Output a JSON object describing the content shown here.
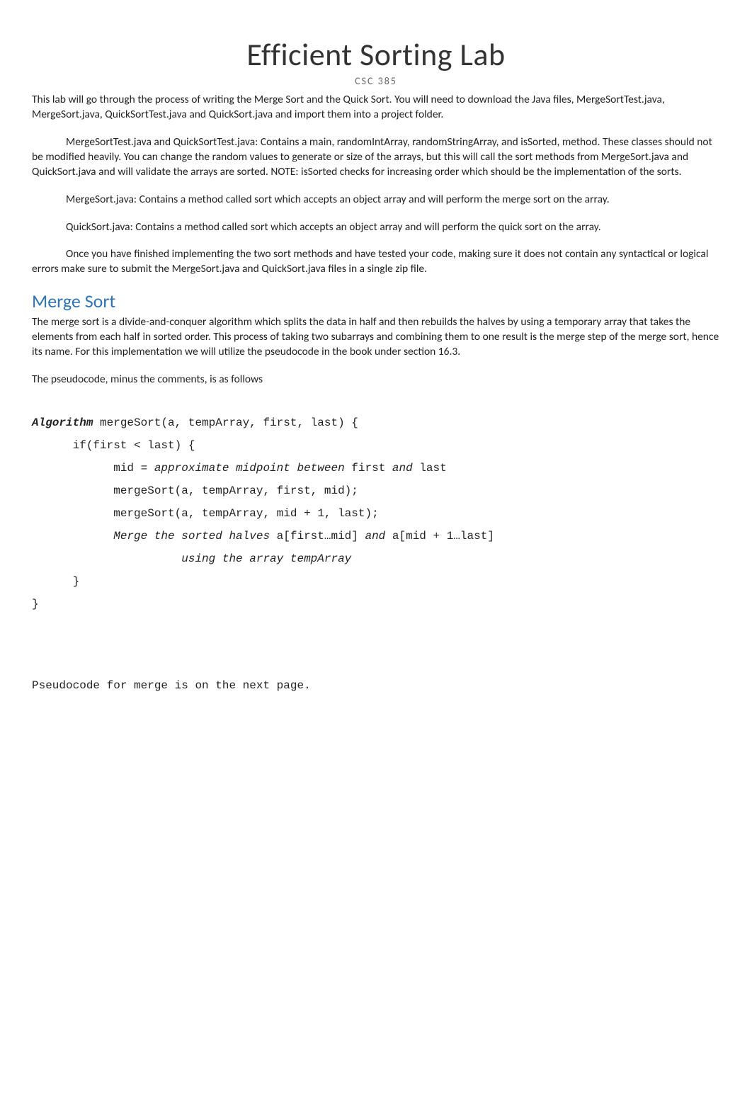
{
  "title": "Efficient Sorting Lab",
  "subtitle": "CSC 385",
  "intro": "This lab will go through the process of writing the Merge Sort and the Quick Sort. You will need to download the Java files, MergeSortTest.java, MergeSort.java, QuickSortTest.java and QuickSort.java and import them into a project folder.",
  "p1": "MergeSortTest.java and QuickSortTest.java: Contains a main, randomIntArray, randomStringArray, and isSorted, method.  These classes should not be modified heavily.  You can change the random values to generate or size of the arrays, but this will call the sort methods from MergeSort.java and QuickSort.java and will validate the arrays are sorted.  NOTE: isSorted checks for increasing order which should be the implementation of the sorts.",
  "p2": "MergeSort.java: Contains a method called sort which accepts an object array and will perform the merge sort on the array.",
  "p3": "QuickSort.java: Contains a method called sort which accepts an object array and will perform the quick sort on the array.",
  "p4": "Once you have finished implementing the two sort methods and have tested your code, making sure it does not contain any syntactical or logical errors make sure to submit the MergeSort.java and QuickSort.java files in a single zip file.",
  "merge_head": "Merge Sort",
  "merge_desc": "The merge sort is a divide-and-conquer algorithm which splits the data in half and then rebuilds the halves by using a temporary array that takes the elements from each half in sorted order.  This process of taking two subarrays and combining them to one result is the merge step of the merge sort, hence its name.  For this implementation we will utilize the pseudocode in the book under section 16.3.",
  "pseu_intro": "The pseudocode, minus the comments, is as follows",
  "code": {
    "l1a": "Algorithm",
    "l1b": " mergeSort(a, tempArray, first, last) {",
    "l2": "      if(first < last) {",
    "l3a": "            mid = ",
    "l3b": "approximate midpoint between ",
    "l3c": "first",
    "l3d": " and ",
    "l3e": "last",
    "l4": "            mergeSort(a, tempArray, first, mid);",
    "l5": "            mergeSort(a, tempArray, mid + 1, last);",
    "l6a": "            ",
    "l6b": "Merge the sorted halves ",
    "l6c": "a[first…mid]",
    "l6d": " and ",
    "l6e": "a[mid + 1…last]",
    "l7": "                      using the array tempArray",
    "l8": "      }",
    "l9": "}"
  },
  "footnote": "Pseudocode for merge is on the next page."
}
